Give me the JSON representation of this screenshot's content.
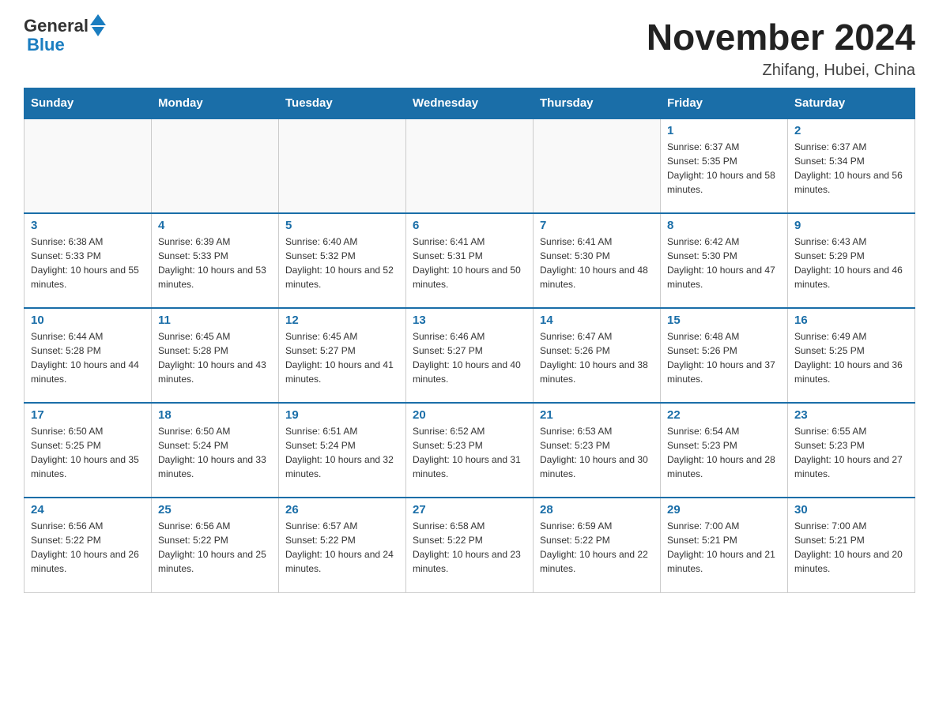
{
  "logo": {
    "text_general": "General",
    "text_blue": "Blue"
  },
  "title": "November 2024",
  "location": "Zhifang, Hubei, China",
  "days_of_week": [
    "Sunday",
    "Monday",
    "Tuesday",
    "Wednesday",
    "Thursday",
    "Friday",
    "Saturday"
  ],
  "weeks": [
    [
      {
        "day": "",
        "info": ""
      },
      {
        "day": "",
        "info": ""
      },
      {
        "day": "",
        "info": ""
      },
      {
        "day": "",
        "info": ""
      },
      {
        "day": "",
        "info": ""
      },
      {
        "day": "1",
        "info": "Sunrise: 6:37 AM\nSunset: 5:35 PM\nDaylight: 10 hours and 58 minutes."
      },
      {
        "day": "2",
        "info": "Sunrise: 6:37 AM\nSunset: 5:34 PM\nDaylight: 10 hours and 56 minutes."
      }
    ],
    [
      {
        "day": "3",
        "info": "Sunrise: 6:38 AM\nSunset: 5:33 PM\nDaylight: 10 hours and 55 minutes."
      },
      {
        "day": "4",
        "info": "Sunrise: 6:39 AM\nSunset: 5:33 PM\nDaylight: 10 hours and 53 minutes."
      },
      {
        "day": "5",
        "info": "Sunrise: 6:40 AM\nSunset: 5:32 PM\nDaylight: 10 hours and 52 minutes."
      },
      {
        "day": "6",
        "info": "Sunrise: 6:41 AM\nSunset: 5:31 PM\nDaylight: 10 hours and 50 minutes."
      },
      {
        "day": "7",
        "info": "Sunrise: 6:41 AM\nSunset: 5:30 PM\nDaylight: 10 hours and 48 minutes."
      },
      {
        "day": "8",
        "info": "Sunrise: 6:42 AM\nSunset: 5:30 PM\nDaylight: 10 hours and 47 minutes."
      },
      {
        "day": "9",
        "info": "Sunrise: 6:43 AM\nSunset: 5:29 PM\nDaylight: 10 hours and 46 minutes."
      }
    ],
    [
      {
        "day": "10",
        "info": "Sunrise: 6:44 AM\nSunset: 5:28 PM\nDaylight: 10 hours and 44 minutes."
      },
      {
        "day": "11",
        "info": "Sunrise: 6:45 AM\nSunset: 5:28 PM\nDaylight: 10 hours and 43 minutes."
      },
      {
        "day": "12",
        "info": "Sunrise: 6:45 AM\nSunset: 5:27 PM\nDaylight: 10 hours and 41 minutes."
      },
      {
        "day": "13",
        "info": "Sunrise: 6:46 AM\nSunset: 5:27 PM\nDaylight: 10 hours and 40 minutes."
      },
      {
        "day": "14",
        "info": "Sunrise: 6:47 AM\nSunset: 5:26 PM\nDaylight: 10 hours and 38 minutes."
      },
      {
        "day": "15",
        "info": "Sunrise: 6:48 AM\nSunset: 5:26 PM\nDaylight: 10 hours and 37 minutes."
      },
      {
        "day": "16",
        "info": "Sunrise: 6:49 AM\nSunset: 5:25 PM\nDaylight: 10 hours and 36 minutes."
      }
    ],
    [
      {
        "day": "17",
        "info": "Sunrise: 6:50 AM\nSunset: 5:25 PM\nDaylight: 10 hours and 35 minutes."
      },
      {
        "day": "18",
        "info": "Sunrise: 6:50 AM\nSunset: 5:24 PM\nDaylight: 10 hours and 33 minutes."
      },
      {
        "day": "19",
        "info": "Sunrise: 6:51 AM\nSunset: 5:24 PM\nDaylight: 10 hours and 32 minutes."
      },
      {
        "day": "20",
        "info": "Sunrise: 6:52 AM\nSunset: 5:23 PM\nDaylight: 10 hours and 31 minutes."
      },
      {
        "day": "21",
        "info": "Sunrise: 6:53 AM\nSunset: 5:23 PM\nDaylight: 10 hours and 30 minutes."
      },
      {
        "day": "22",
        "info": "Sunrise: 6:54 AM\nSunset: 5:23 PM\nDaylight: 10 hours and 28 minutes."
      },
      {
        "day": "23",
        "info": "Sunrise: 6:55 AM\nSunset: 5:23 PM\nDaylight: 10 hours and 27 minutes."
      }
    ],
    [
      {
        "day": "24",
        "info": "Sunrise: 6:56 AM\nSunset: 5:22 PM\nDaylight: 10 hours and 26 minutes."
      },
      {
        "day": "25",
        "info": "Sunrise: 6:56 AM\nSunset: 5:22 PM\nDaylight: 10 hours and 25 minutes."
      },
      {
        "day": "26",
        "info": "Sunrise: 6:57 AM\nSunset: 5:22 PM\nDaylight: 10 hours and 24 minutes."
      },
      {
        "day": "27",
        "info": "Sunrise: 6:58 AM\nSunset: 5:22 PM\nDaylight: 10 hours and 23 minutes."
      },
      {
        "day": "28",
        "info": "Sunrise: 6:59 AM\nSunset: 5:22 PM\nDaylight: 10 hours and 22 minutes."
      },
      {
        "day": "29",
        "info": "Sunrise: 7:00 AM\nSunset: 5:21 PM\nDaylight: 10 hours and 21 minutes."
      },
      {
        "day": "30",
        "info": "Sunrise: 7:00 AM\nSunset: 5:21 PM\nDaylight: 10 hours and 20 minutes."
      }
    ]
  ]
}
